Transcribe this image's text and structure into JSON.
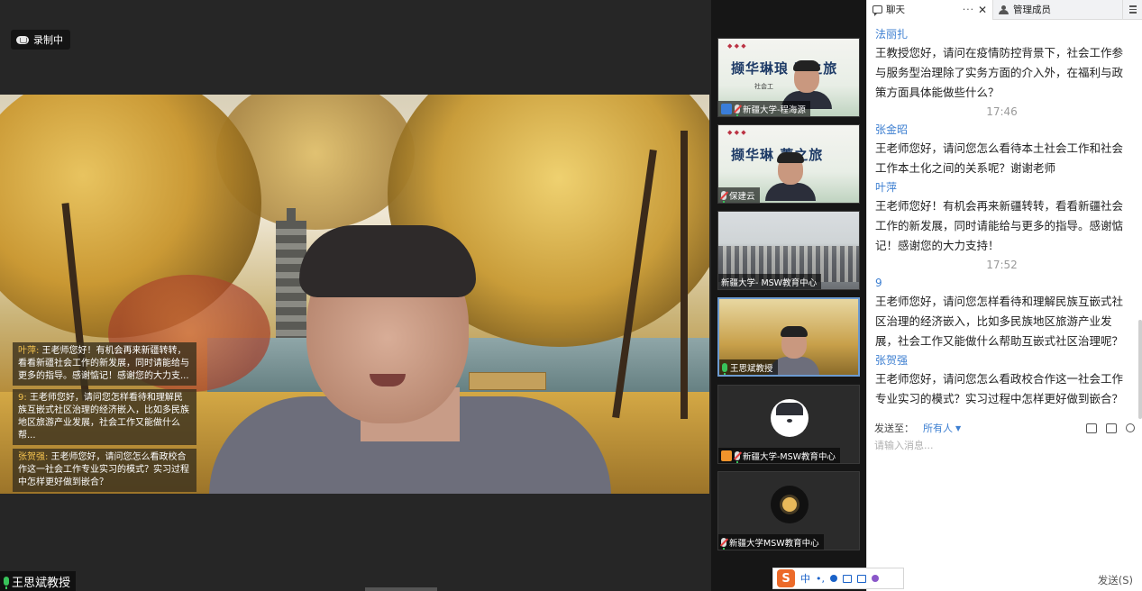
{
  "main": {
    "recording_label": "录制中",
    "speaker_name": "王思斌教授",
    "overlay_messages": [
      {
        "sender": "叶萍:",
        "text": " 王老师您好！有机会再来新疆转转，看看新疆社会工作的新发展，同时请能给与更多的指导。感谢惦记！感谢您的大力支..."
      },
      {
        "sender": "9:",
        "text": " 王老师您好，请问您怎样看待和理解民族互嵌式社区治理的经济嵌入，比如多民族地区旅游产业发展，社会工作又能做什么帮..."
      },
      {
        "sender": "张贺强:",
        "text": " 王老师您好，请问您怎么看政校合作这一社会工作专业实习的模式？实习过程中怎样更好做到嵌合？"
      }
    ]
  },
  "thumbnails": [
    {
      "label": "新疆大学-程海源",
      "slide_text": "撷华琳琅 菁之旅",
      "slide_small": "社会工"
    },
    {
      "label": "保建云",
      "slide_text": "撷华琳 菁之旅"
    },
    {
      "label": "新疆大学- MSW教育中心"
    },
    {
      "label": "王思斌教授"
    },
    {
      "label": "新疆大学-MSW教育中心"
    },
    {
      "label": "新疆大学MSW教育中心"
    }
  ],
  "chat": {
    "tab_chat": "聊天",
    "tab_members": "管理成员",
    "more_label": "···",
    "close_label": "✕",
    "messages": [
      {
        "type": "msg",
        "name": "法丽扎",
        "text": "王教授您好，请问在疫情防控背景下，社会工作参与服务型治理除了实务方面的介入外，在福利与政策方面具体能做些什么？"
      },
      {
        "type": "time",
        "text": "17:46"
      },
      {
        "type": "msg",
        "name": "张金昭",
        "text": "王老师您好，请问您怎么看待本土社会工作和社会工作本土化之间的关系呢？谢谢老师"
      },
      {
        "type": "msg",
        "name": "叶萍",
        "text": "王老师您好！有机会再来新疆转转，看看新疆社会工作的新发展，同时请能给与更多的指导。感谢惦记！感谢您的大力支持！"
      },
      {
        "type": "time",
        "text": "17:52"
      },
      {
        "type": "msg",
        "name": "9",
        "text": "王老师您好，请问您怎样看待和理解民族互嵌式社区治理的经济嵌入，比如多民族地区旅游产业发展，社会工作又能做什么帮助互嵌式社区治理呢？"
      },
      {
        "type": "msg",
        "name": "张贺强",
        "text": "王老师您好，请问您怎么看政校合作这一社会工作专业实习的模式？实习过程中怎样更好做到嵌合？"
      }
    ],
    "send_to_label": "发送至：",
    "send_to_value": "所有人",
    "input_placeholder": "请输入消息...",
    "send_button": "发送(S)"
  },
  "ime": {
    "logo": "S",
    "lang": "中",
    "punct": "•,"
  }
}
